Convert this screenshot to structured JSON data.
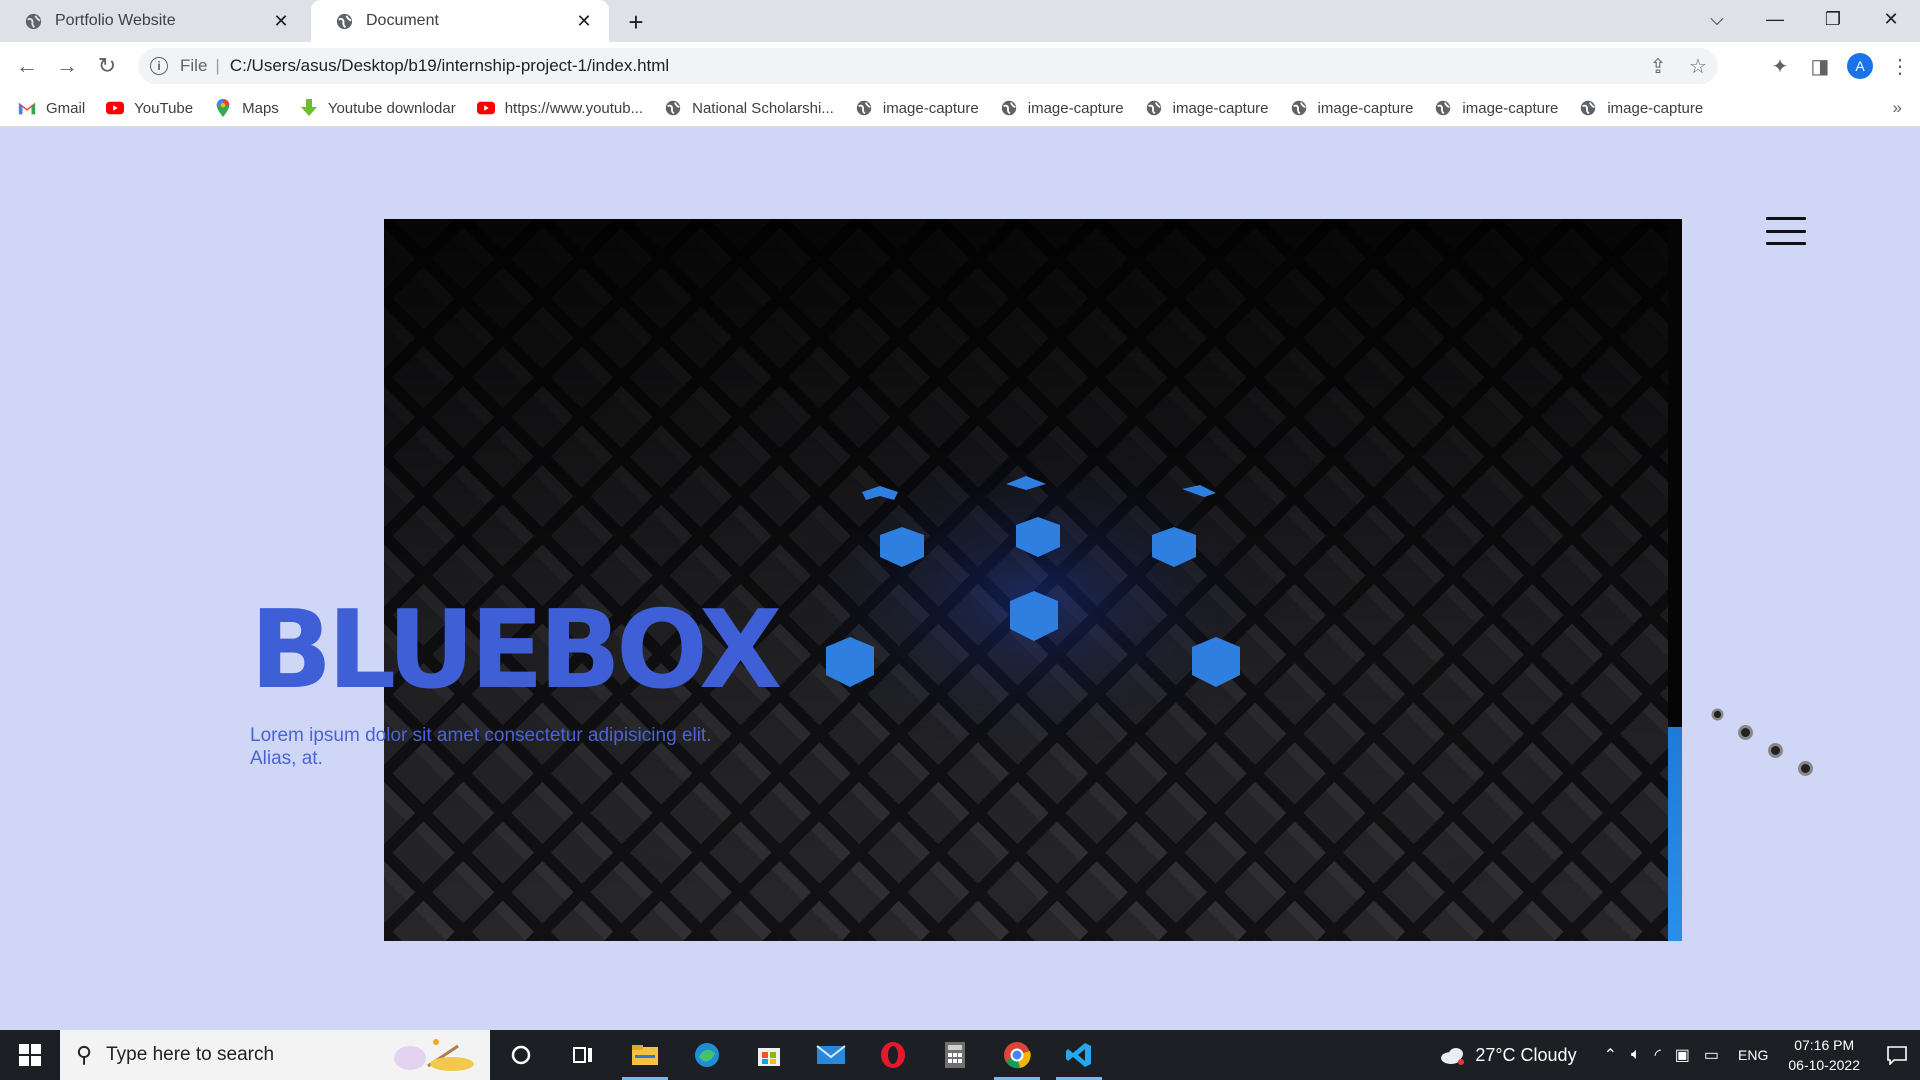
{
  "browser": {
    "tabs": [
      {
        "title": "Portfolio Website",
        "active": false
      },
      {
        "title": "Document",
        "active": true
      }
    ],
    "address": {
      "scheme_label": "File",
      "url": "C:/Users/asus/Desktop/b19/internship-project-1/index.html"
    },
    "profile_initial": "A",
    "bookmarks": [
      {
        "label": "Gmail",
        "icon": "gmail-icon"
      },
      {
        "label": "YouTube",
        "icon": "youtube-icon"
      },
      {
        "label": "Maps",
        "icon": "maps-icon"
      },
      {
        "label": "Youtube downlodar",
        "icon": "download-icon"
      },
      {
        "label": "https://www.youtub...",
        "icon": "youtube-icon"
      },
      {
        "label": "National Scholarshi...",
        "icon": "globe-icon"
      },
      {
        "label": "image-capture",
        "icon": "globe-icon"
      },
      {
        "label": "image-capture",
        "icon": "globe-icon"
      },
      {
        "label": "image-capture",
        "icon": "globe-icon"
      },
      {
        "label": "image-capture",
        "icon": "globe-icon"
      },
      {
        "label": "image-capture",
        "icon": "globe-icon"
      },
      {
        "label": "image-capture",
        "icon": "globe-icon"
      }
    ],
    "bookmarks_more": "»"
  },
  "page": {
    "brand": "BLUEBOX",
    "description": "Lorem ipsum dolor sit amet consectetur adipisicing elit. Alias, at.",
    "accent_color": "#3f5fd6",
    "background_color": "#d0d7f6"
  },
  "taskbar": {
    "search_placeholder": "Type here to search",
    "weather": "27°C  Cloudy",
    "language": "ENG",
    "time": "07:16 PM",
    "date": "06-10-2022"
  }
}
